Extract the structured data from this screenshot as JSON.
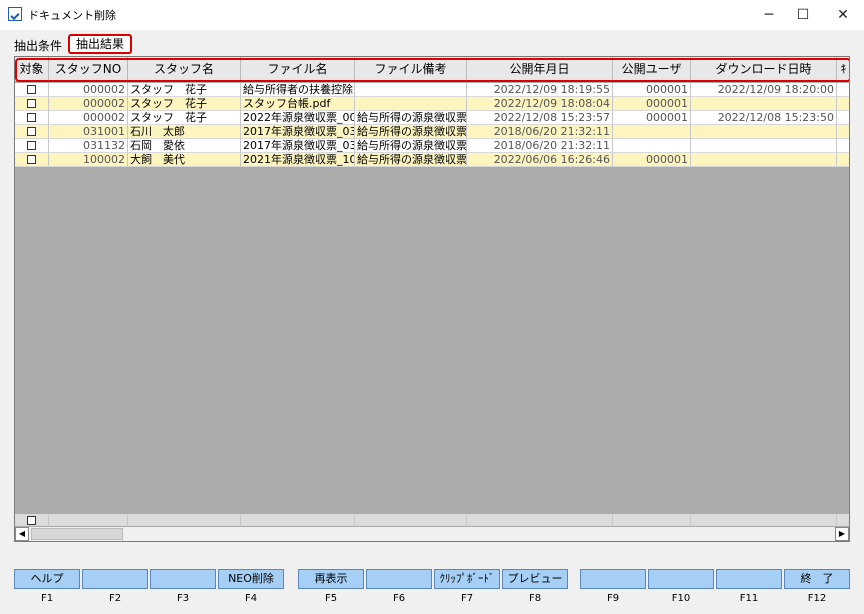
{
  "window": {
    "title": "ドキュメント削除",
    "controls": {
      "minimize": "─",
      "maximize": "☐",
      "close": "✕"
    }
  },
  "tabs": [
    {
      "label": "抽出条件"
    },
    {
      "label": "抽出結果",
      "active": true
    }
  ],
  "table": {
    "columns": [
      "対象",
      "スタッフNO",
      "スタッフ名",
      "ファイル名",
      "ファイル備考",
      "公開年月日",
      "公開ユーザ",
      "ダウンロード日時",
      "ｷ"
    ],
    "rows": [
      {
        "staff_no": "000002",
        "staff_name": "スタッフ　花子",
        "file_name": "給与所得者の扶養控除",
        "file_note": "",
        "published": "2022/12/09 18:19:55",
        "user": "000001",
        "downloaded": "2022/12/09 18:20:00"
      },
      {
        "staff_no": "000002",
        "staff_name": "スタッフ　花子",
        "file_name": "スタッフ台帳.pdf",
        "file_note": "",
        "published": "2022/12/09 18:08:04",
        "user": "000001",
        "downloaded": ""
      },
      {
        "staff_no": "000002",
        "staff_name": "スタッフ　花子",
        "file_name": "2022年源泉徴収票_00",
        "file_note": "給与所得の源泉徴収票",
        "published": "2022/12/08 15:23:57",
        "user": "000001",
        "downloaded": "2022/12/08 15:23:50"
      },
      {
        "staff_no": "031001",
        "staff_name": "石川　太郎",
        "file_name": "2017年源泉徴収票_03",
        "file_note": "給与所得の源泉徴収票",
        "published": "2018/06/20 21:32:11",
        "user": "",
        "downloaded": ""
      },
      {
        "staff_no": "031132",
        "staff_name": "石岡　愛依",
        "file_name": "2017年源泉徴収票_03",
        "file_note": "給与所得の源泉徴収票",
        "published": "2018/06/20 21:32:11",
        "user": "",
        "downloaded": ""
      },
      {
        "staff_no": "100002",
        "staff_name": "大飼　美代",
        "file_name": "2021年源泉徴収票_10",
        "file_note": "給与所得の源泉徴収票",
        "published": "2022/06/06 16:26:46",
        "user": "000001",
        "downloaded": ""
      }
    ]
  },
  "scrollbar": {
    "left_arrow": "◀",
    "right_arrow": "▶"
  },
  "function_keys": [
    {
      "label": "ヘルプ",
      "key": "F1"
    },
    {
      "label": "",
      "key": "F2"
    },
    {
      "label": "",
      "key": "F3"
    },
    {
      "label": "NEO削除",
      "key": "F4"
    },
    {
      "label": "再表示",
      "key": "F5"
    },
    {
      "label": "",
      "key": "F6"
    },
    {
      "label": "ｸﾘｯﾌﾟﾎﾞｰﾄﾞ",
      "key": "F7"
    },
    {
      "label": "プレビュー",
      "key": "F8"
    },
    {
      "label": "",
      "key": "F9"
    },
    {
      "label": "",
      "key": "F10"
    },
    {
      "label": "",
      "key": "F11"
    },
    {
      "label": "終　了",
      "key": "F12"
    }
  ],
  "colors": {
    "row_odd": "#ffffff",
    "row_even": "#fdf5c0",
    "fkey_bg": "#a6cff5",
    "highlight": "#dd0000"
  }
}
